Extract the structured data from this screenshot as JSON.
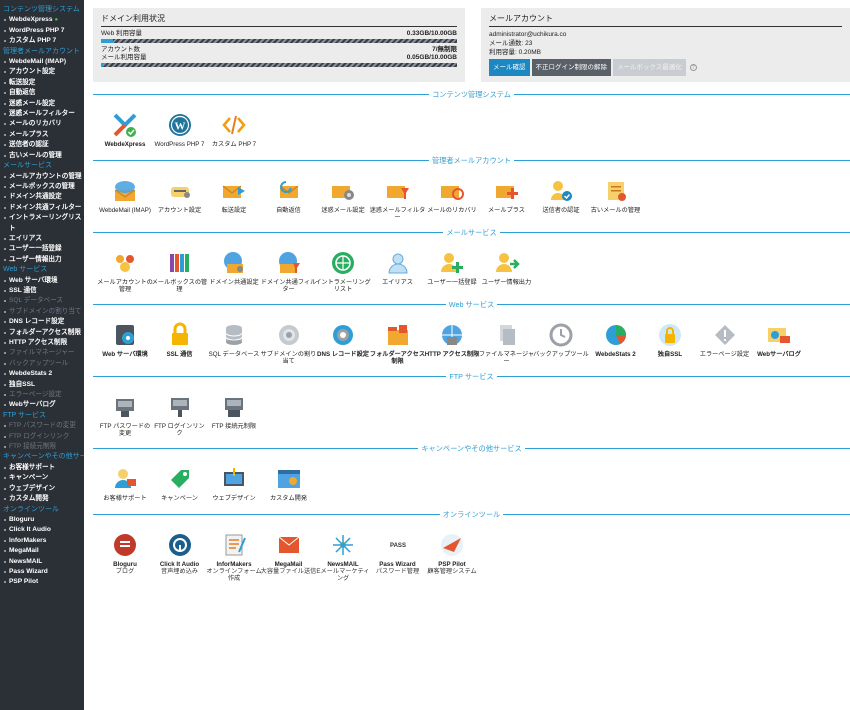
{
  "sidebar": {
    "groups": [
      {
        "head": "コンテンツ管理システム",
        "items": [
          {
            "label": "WebdeXpress",
            "ok": true
          },
          {
            "label": "WordPress PHP 7"
          },
          {
            "label": "カスタム PHP 7"
          }
        ]
      },
      {
        "head": "管理者メールアカウント",
        "items": [
          {
            "label": "WebdeMail (IMAP)"
          },
          {
            "label": "アカウント設定"
          },
          {
            "label": "転送設定"
          },
          {
            "label": "自動返信"
          },
          {
            "label": "迷惑メール設定"
          },
          {
            "label": "迷惑メールフィルター"
          },
          {
            "label": "メールのリカバリ"
          },
          {
            "label": "メールプラス"
          },
          {
            "label": "送信者の認証"
          },
          {
            "label": "古いメールの管理"
          }
        ]
      },
      {
        "head": "メールサービス",
        "items": [
          {
            "label": "メールアカウントの管理"
          },
          {
            "label": "メールボックスの管理"
          },
          {
            "label": "ドメイン共通設定"
          },
          {
            "label": "ドメイン共通フィルター"
          },
          {
            "label": "イントラメーリングリスト"
          },
          {
            "label": "エイリアス"
          },
          {
            "label": "ユーザー一括登録"
          },
          {
            "label": "ユーザー情報出力"
          }
        ]
      },
      {
        "head": "Web サービス",
        "items": [
          {
            "label": "Web サーバ環境"
          },
          {
            "label": "SSL 通信"
          },
          {
            "label": "SQL データベース",
            "dim": true
          },
          {
            "label": "サブドメインの割り当て",
            "dim": true
          },
          {
            "label": "DNS レコード設定"
          },
          {
            "label": "フォルダーアクセス制限"
          },
          {
            "label": "HTTP アクセス制限"
          },
          {
            "label": "ファイルマネージャー",
            "dim": true
          },
          {
            "label": "バックアップツール",
            "dim": true
          },
          {
            "label": "WebdeStats 2"
          },
          {
            "label": "独自SSL"
          },
          {
            "label": "エラーページ設定",
            "dim": true
          },
          {
            "label": "Webサーバログ"
          }
        ]
      },
      {
        "head": "FTP サービス",
        "items": [
          {
            "label": "FTP パスワードの変更",
            "dim": true
          },
          {
            "label": "FTP ログインリンク",
            "dim": true
          },
          {
            "label": "FTP 接続元制限",
            "dim": true
          }
        ]
      },
      {
        "head": "キャンペーンやその他サービス",
        "items": [
          {
            "label": "お客様サポート"
          },
          {
            "label": "キャンペーン"
          },
          {
            "label": "ウェブデザイン"
          },
          {
            "label": "カスタム開発"
          }
        ]
      },
      {
        "head": "オンラインツール",
        "items": [
          {
            "label": "Bloguru"
          },
          {
            "label": "Click It Audio"
          },
          {
            "label": "InforMakers"
          },
          {
            "label": "MegaMail"
          },
          {
            "label": "NewsMAIL"
          },
          {
            "label": "Pass Wizard"
          },
          {
            "label": "PSP Pilot"
          }
        ]
      }
    ]
  },
  "domain_status": {
    "title": "ドメイン利用状況",
    "web_label": "Web 利用容量",
    "web_value": "0.33GB/10.00GB",
    "web_fraction": 0.033,
    "accounts_label": "アカウント数",
    "accounts_value": "7/無制限",
    "mail_label": "メール利用容量",
    "mail_value": "0.05GB/10.00GB",
    "mail_fraction": 0.005
  },
  "mail_account": {
    "title": "メールアカウント",
    "address": "administrator@uchikura.co",
    "count_line": "メール通数: 23",
    "usage_line": "利用容量: 0.20MB",
    "btn_check": "メール確認",
    "btn_unlock": "不正ログイン制限の解除",
    "btn_mailbox": "メールボックス最適化"
  },
  "sections": [
    {
      "title": "コンテンツ管理システム",
      "items": [
        {
          "label": "WebdeXpress",
          "bold": true,
          "icon": "webdexpress-icon"
        },
        {
          "label": "WordPress PHP 7",
          "icon": "wordpress-icon"
        },
        {
          "label": "カスタム PHP 7",
          "icon": "code-icon"
        }
      ]
    },
    {
      "title": "管理者メールアカウント",
      "items": [
        {
          "label": "WebdeMail (IMAP)",
          "icon": "webmail-icon"
        },
        {
          "label": "アカウント設定",
          "icon": "account-settings-icon"
        },
        {
          "label": "転送設定",
          "icon": "mail-forward-icon"
        },
        {
          "label": "自動返信",
          "icon": "auto-reply-icon"
        },
        {
          "label": "迷惑メール設定",
          "icon": "spam-settings-icon"
        },
        {
          "label": "迷惑メールフィルター",
          "icon": "spam-filter-icon"
        },
        {
          "label": "メールのリカバリ",
          "icon": "mail-recovery-icon"
        },
        {
          "label": "メールプラス",
          "icon": "mail-plus-icon"
        },
        {
          "label": "送信者の認証",
          "icon": "sender-auth-icon"
        },
        {
          "label": "古いメールの管理",
          "icon": "old-mail-icon"
        }
      ]
    },
    {
      "title": "メールサービス",
      "items": [
        {
          "label": "メールアカウントの管理",
          "icon": "mail-accounts-icon"
        },
        {
          "label": "メールボックスの管理",
          "icon": "mailbox-icon"
        },
        {
          "label": "ドメイン共通設定",
          "icon": "domain-settings-icon"
        },
        {
          "label": "ドメイン共通フィルター",
          "icon": "domain-filter-icon"
        },
        {
          "label": "イントラメーリングリスト",
          "icon": "mailing-list-icon"
        },
        {
          "label": "エイリアス",
          "icon": "alias-icon"
        },
        {
          "label": "ユーザー一括登録",
          "icon": "bulk-user-icon"
        },
        {
          "label": "ユーザー情報出力",
          "icon": "user-export-icon"
        }
      ]
    },
    {
      "title": "Web サービス",
      "items": [
        {
          "label": "Web サーバ環境",
          "bold": true,
          "icon": "server-env-icon"
        },
        {
          "label": "SSL 通信",
          "bold": true,
          "icon": "ssl-lock-icon"
        },
        {
          "label": "SQL データベース",
          "icon": "database-icon"
        },
        {
          "label": "サブドメインの割り当て",
          "icon": "subdomain-icon"
        },
        {
          "label": "DNS レコード設定",
          "bold": true,
          "icon": "dns-icon"
        },
        {
          "label": "フォルダーアクセス制限",
          "bold": true,
          "icon": "folder-access-icon"
        },
        {
          "label": "HTTP アクセス制限",
          "bold": true,
          "icon": "http-access-icon"
        },
        {
          "label": "ファイルマネージャー",
          "icon": "file-manager-icon"
        },
        {
          "label": "バックアップツール",
          "icon": "backup-icon"
        },
        {
          "label": "WebdeStats 2",
          "bold": true,
          "icon": "stats-icon"
        },
        {
          "label": "独自SSL",
          "bold": true,
          "icon": "custom-ssl-icon"
        },
        {
          "label": "エラーページ設定",
          "icon": "error-page-icon"
        },
        {
          "label": "Webサーバログ",
          "bold": true,
          "icon": "server-log-icon"
        }
      ]
    },
    {
      "title": "FTP サービス",
      "items": [
        {
          "label": "FTP パスワードの変更",
          "icon": "ftp-password-icon"
        },
        {
          "label": "FTP ログインリンク",
          "icon": "ftp-login-icon"
        },
        {
          "label": "FTP 接続元制限",
          "icon": "ftp-restrict-icon"
        }
      ]
    },
    {
      "title": "キャンペーンやその他サービス",
      "items": [
        {
          "label": "お客様サポート",
          "icon": "support-icon"
        },
        {
          "label": "キャンペーン",
          "icon": "campaign-tag-icon"
        },
        {
          "label": "ウェブデザイン",
          "icon": "web-design-icon"
        },
        {
          "label": "カスタム開発",
          "icon": "custom-dev-icon"
        }
      ]
    },
    {
      "title": "オンラインツール",
      "items": [
        {
          "label": "Bloguru",
          "sub": "ブログ",
          "bold": true,
          "icon": "bloguru-icon"
        },
        {
          "label": "Click It Audio",
          "sub": "音声埋め込み",
          "bold": true,
          "icon": "clickitaudio-icon"
        },
        {
          "label": "InforMakers",
          "sub": "オンラインフォーム作成",
          "bold": true,
          "icon": "informakers-icon"
        },
        {
          "label": "MegaMail",
          "sub": "大容量ファイル送信",
          "bold": true,
          "icon": "megamail-icon"
        },
        {
          "label": "NewsMAIL",
          "sub": "Eメールマーケティング",
          "bold": true,
          "icon": "newsmail-icon"
        },
        {
          "label": "Pass Wizard",
          "sub": "パスワード管理",
          "bold": true,
          "icon": "passwizard-icon"
        },
        {
          "label": "PSP Pilot",
          "sub": "顧客管理システム",
          "bold": true,
          "icon": "psppilot-icon"
        }
      ]
    }
  ],
  "colors": {
    "accent": "#2e9fd6",
    "sidebar_bg": "#2b2f36",
    "button_blue": "#1d87c1"
  }
}
